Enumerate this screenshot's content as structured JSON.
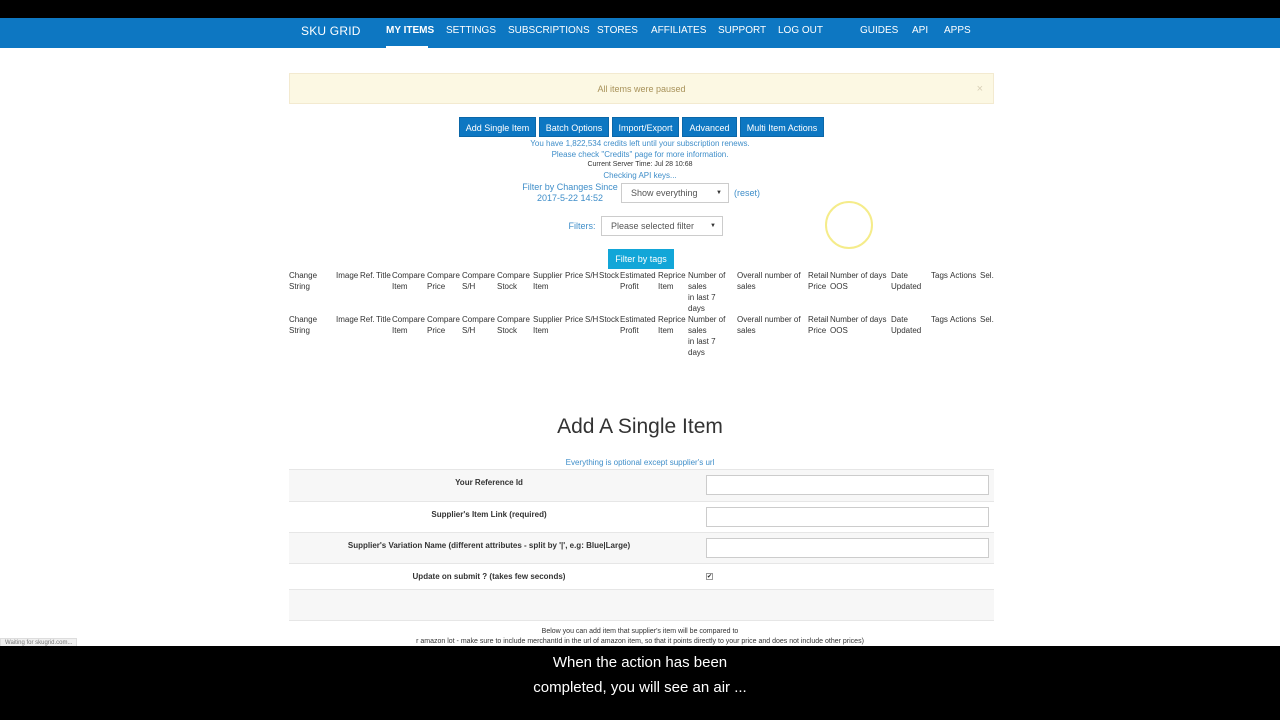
{
  "nav": {
    "brand": "SKU GRID",
    "items": [
      "MY ITEMS",
      "SETTINGS",
      "SUBSCRIPTIONS",
      "STORES",
      "AFFILIATES",
      "SUPPORT",
      "LOG OUT",
      "GUIDES",
      "API",
      "APPS"
    ]
  },
  "alert": {
    "text": "All items were paused",
    "close": "×"
  },
  "buttons": [
    "Add Single Item",
    "Batch Options",
    "Import/Export",
    "Advanced",
    "Multi Item Actions"
  ],
  "info": {
    "credits": "You have 1,822,534 credits left until your subscription renews.",
    "check": "Please check \"Credits\" page for more information.",
    "server_time": "Current Server Time: Jul 28 10:68",
    "api": "Checking API keys..."
  },
  "filter_changes": {
    "label_line1": "Filter by Changes Since",
    "label_line2": "2017-5-22 14:52",
    "selected": "Show everything",
    "reset": "(reset)"
  },
  "filters": {
    "label": "Filters:",
    "selected": "Please selected filter"
  },
  "filter_tags_button": "Filter by tags",
  "table_headers": [
    [
      "Change",
      "String"
    ],
    [
      "Image"
    ],
    [
      "Ref."
    ],
    [
      "Title"
    ],
    [
      "Compare",
      "Item"
    ],
    [
      "Compare",
      "Price"
    ],
    [
      "Compare",
      "S/H"
    ],
    [
      "Compare",
      "Stock"
    ],
    [
      "Supplier",
      "Item"
    ],
    [
      "Price"
    ],
    [
      "S/H"
    ],
    [
      "Stock"
    ],
    [
      "Estimated",
      "Profit"
    ],
    [
      "Reprice",
      "Item"
    ],
    [
      "Number of",
      "sales",
      "in last 7",
      "days"
    ],
    [
      "Overall number of",
      "sales"
    ],
    [
      "Retail",
      "Price"
    ],
    [
      "Number of days",
      "OOS"
    ],
    [
      "Date",
      "Updated"
    ],
    [
      "Tags"
    ],
    [
      "Actions"
    ],
    [
      "Sel."
    ]
  ],
  "add_item": {
    "title": "Add A Single Item",
    "subtitle": "Everything is optional except supplier's url",
    "fields": [
      "Your Reference Id",
      "Supplier's Item Link (required)",
      "Supplier's Variation Name (different attributes - split by '|', e.g: Blue|Large)",
      "Update on submit ? (takes few seconds)"
    ],
    "checkbox_mark": "✔",
    "note1": "Below you can add item that supplier's item will be compared to",
    "note2": "r amazon lot - make sure to include merchantId in the url of amazon item, so that it points directly to your price and does not include other prices)"
  },
  "status_bar": "Waiting for skugrid.com...",
  "caption": {
    "line1": "When the action has been",
    "line2": "completed, you will see an air ..."
  }
}
